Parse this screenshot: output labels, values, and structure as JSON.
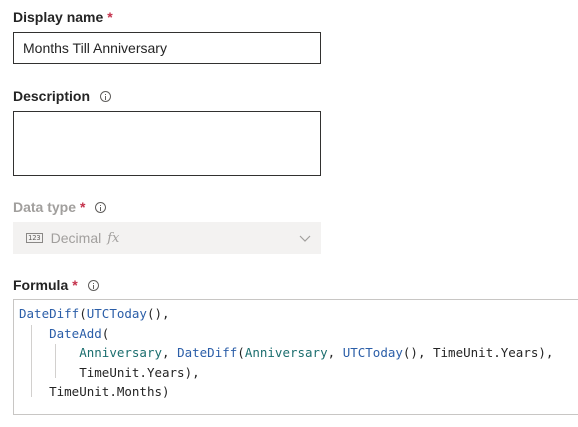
{
  "display_name": {
    "label": "Display name",
    "required": "*",
    "value": "Months Till Anniversary"
  },
  "description": {
    "label": "Description",
    "value": ""
  },
  "data_type": {
    "label": "Data type",
    "required": "*",
    "value": "Decimal",
    "icon": "number-icon",
    "fx": "fx"
  },
  "formula": {
    "label": "Formula",
    "required": "*",
    "lines": [
      {
        "indent": 0,
        "tokens": [
          {
            "t": "fn",
            "v": "DateDiff"
          },
          {
            "t": "p",
            "v": "("
          },
          {
            "t": "fn",
            "v": "UTCToday"
          },
          {
            "t": "p",
            "v": "(),"
          }
        ]
      },
      {
        "indent": 1,
        "tokens": [
          {
            "t": "fn",
            "v": "DateAdd"
          },
          {
            "t": "p",
            "v": "("
          }
        ]
      },
      {
        "indent": 2,
        "tokens": [
          {
            "t": "id",
            "v": "Anniversary"
          },
          {
            "t": "p",
            "v": ", "
          },
          {
            "t": "fn",
            "v": "DateDiff"
          },
          {
            "t": "p",
            "v": "("
          },
          {
            "t": "id",
            "v": "Anniversary"
          },
          {
            "t": "p",
            "v": ", "
          },
          {
            "t": "fn",
            "v": "UTCToday"
          },
          {
            "t": "p",
            "v": "(), TimeUnit.Years),"
          }
        ]
      },
      {
        "indent": 2,
        "tokens": [
          {
            "t": "p",
            "v": "TimeUnit.Years),"
          }
        ]
      },
      {
        "indent": 1,
        "tokens": [
          {
            "t": "p",
            "v": "TimeUnit.Months)"
          }
        ]
      }
    ]
  }
}
